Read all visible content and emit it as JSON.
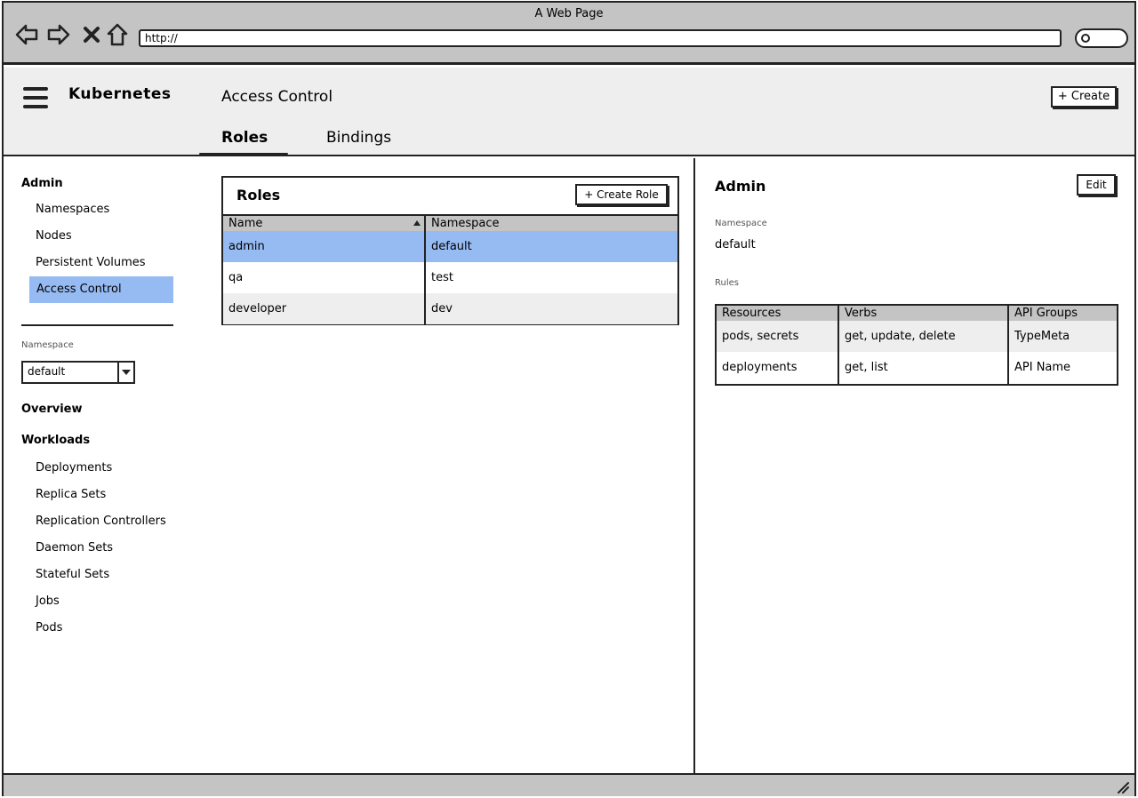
{
  "browser": {
    "window_title": "A Web Page",
    "url": "http://"
  },
  "header": {
    "brand": "Kubernetes",
    "page_title": "Access Control",
    "create_label": "+ Create",
    "tabs": [
      {
        "label": "Roles",
        "active": true
      },
      {
        "label": "Bindings",
        "active": false
      }
    ]
  },
  "sidebar": {
    "admin_heading": "Admin",
    "admin_items": [
      {
        "label": "Namespaces"
      },
      {
        "label": "Nodes"
      },
      {
        "label": "Persistent Volumes"
      },
      {
        "label": "Access Control",
        "selected": true
      }
    ],
    "namespace_label": "Namespace",
    "namespace_value": "default",
    "overview_heading": "Overview",
    "workloads_heading": "Workloads",
    "workload_items": [
      {
        "label": "Deployments"
      },
      {
        "label": "Replica Sets"
      },
      {
        "label": "Replication Controllers"
      },
      {
        "label": "Daemon Sets"
      },
      {
        "label": "Stateful Sets"
      },
      {
        "label": "Jobs"
      },
      {
        "label": "Pods"
      }
    ]
  },
  "roles_panel": {
    "title": "Roles",
    "create_role_label": "+ Create Role",
    "columns": [
      "Name",
      "Namespace"
    ],
    "rows": [
      {
        "name": "admin",
        "namespace": "default",
        "selected": true
      },
      {
        "name": "qa",
        "namespace": "test"
      },
      {
        "name": "developer",
        "namespace": "dev"
      }
    ]
  },
  "detail": {
    "title": "Admin",
    "edit_label": "Edit",
    "namespace_label": "Namespace",
    "namespace_value": "default",
    "rules_label": "Rules",
    "rules_columns": [
      "Resources",
      "Verbs",
      "API Groups"
    ],
    "rules_rows": [
      {
        "resources": "pods, secrets",
        "verbs": "get, update, delete",
        "api_groups": "TypeMeta"
      },
      {
        "resources": "deployments",
        "verbs": "get, list",
        "api_groups": "API Name"
      }
    ]
  },
  "colors": {
    "selection": "#96baf2",
    "chrome": "#c4c4c4",
    "header_bg": "#eeeeee",
    "stripe": "#eeeeee"
  }
}
